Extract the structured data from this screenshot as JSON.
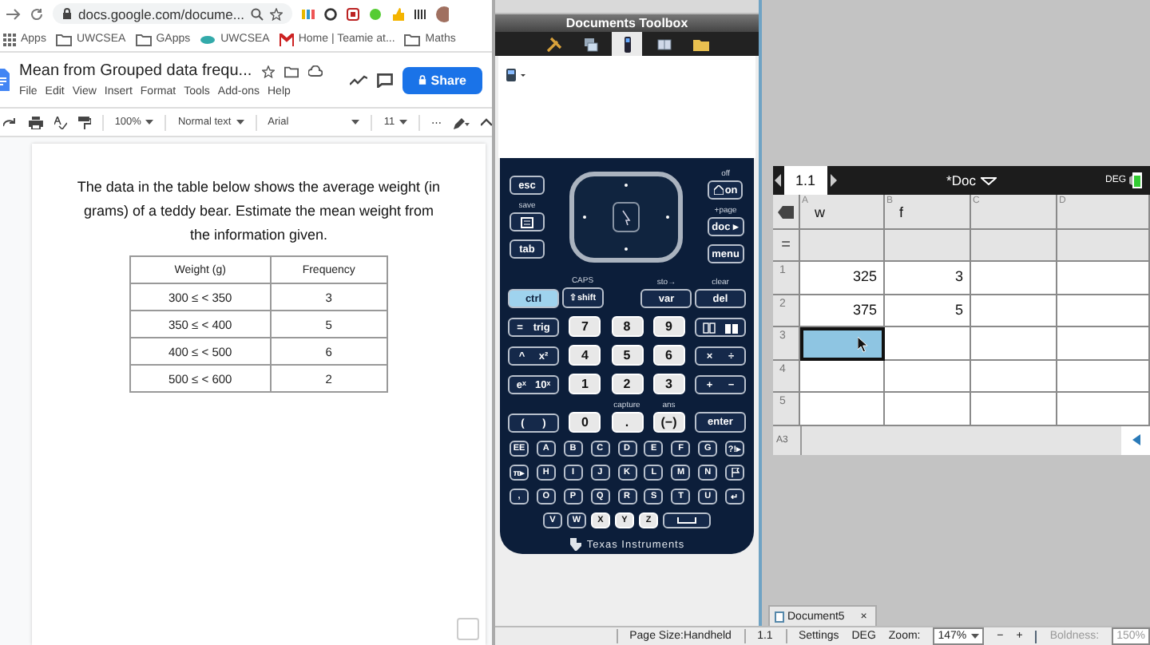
{
  "browser": {
    "url": "docs.google.com/docume...",
    "bookmarks": [
      {
        "label": "Apps",
        "kind": "apps"
      },
      {
        "label": "UWCSEA",
        "kind": "folder"
      },
      {
        "label": "GApps",
        "kind": "folder"
      },
      {
        "label": "UWCSEA",
        "kind": "site"
      },
      {
        "label": "Home | Teamie at...",
        "kind": "teamie"
      },
      {
        "label": "Maths",
        "kind": "folder"
      }
    ],
    "doc_title": "Mean from Grouped data frequ...",
    "menus": [
      "File",
      "Edit",
      "View",
      "Insert",
      "Format",
      "Tools",
      "Add-ons",
      "Help"
    ],
    "share": "Share",
    "toolbar": {
      "zoom": "100%",
      "style": "Normal text",
      "font": "Arial",
      "size": "11",
      "more": "⋯"
    },
    "paragraph": "The data in the table below shows the average weight (in grams) of a teddy bear. Estimate the mean weight from the information given.",
    "table": {
      "columns": [
        "Weight (g)",
        "Frequency"
      ],
      "rows": [
        [
          "300 ≤ < 350",
          "3"
        ],
        [
          "350 ≤ < 400",
          "5"
        ],
        [
          "400 ≤ < 500",
          "6"
        ],
        [
          "500 ≤ < 600",
          "2"
        ]
      ]
    }
  },
  "calculator": {
    "title": "Documents Toolbox",
    "toolbox_tabs": [
      {
        "kind": "utilities",
        "selected": false
      },
      {
        "kind": "explorer",
        "selected": false
      },
      {
        "kind": "keypad",
        "selected": true
      },
      {
        "kind": "book",
        "selected": false
      },
      {
        "kind": "folder",
        "selected": false
      }
    ],
    "keypad": {
      "top_left": [
        {
          "label": "esc",
          "kind": "text"
        },
        {
          "caption": "save",
          "kind": "scratchpad"
        },
        {
          "label": "tab",
          "kind": "text"
        }
      ],
      "top_right": [
        {
          "label": "on",
          "caption": "off",
          "kind": "home"
        },
        {
          "label": "doc ▸",
          "caption": "+page",
          "kind": "text"
        },
        {
          "label": "menu",
          "kind": "text"
        }
      ],
      "ctrl_key": {
        "label": "ctrl",
        "active": true
      },
      "control_row": [
        {
          "label": "⇧shift",
          "caption": "CAPS"
        },
        {
          "label": "var",
          "caption": "sto→"
        },
        {
          "label": "del",
          "caption": "clear"
        }
      ],
      "numeric_rows": [
        [
          {
            "kind": "pair",
            "labels": [
              "=",
              "trig"
            ]
          },
          {
            "kind": "digit",
            "label": "7"
          },
          {
            "kind": "digit",
            "label": "8"
          },
          {
            "kind": "digit",
            "label": "9"
          },
          {
            "kind": "pair-icons"
          }
        ],
        [
          {
            "kind": "pair",
            "labels": [
              "^",
              "x²"
            ]
          },
          {
            "kind": "digit",
            "label": "4"
          },
          {
            "kind": "digit",
            "label": "5"
          },
          {
            "kind": "digit",
            "label": "6"
          },
          {
            "kind": "pair",
            "labels": [
              "×",
              "÷"
            ]
          }
        ],
        [
          {
            "kind": "pair",
            "labels": [
              "eˣ",
              "10ˣ"
            ]
          },
          {
            "kind": "digit",
            "label": "1"
          },
          {
            "kind": "digit",
            "label": "2"
          },
          {
            "kind": "digit",
            "label": "3"
          },
          {
            "kind": "pair",
            "labels": [
              "+",
              "−"
            ]
          }
        ],
        [
          {
            "kind": "pair",
            "labels": [
              "(",
              ")"
            ]
          },
          {
            "kind": "digit",
            "label": "0"
          },
          {
            "kind": "digit",
            "label": ".",
            "caption": "capture"
          },
          {
            "kind": "digit",
            "label": "(−)",
            "caption": "ans"
          },
          {
            "kind": "dark",
            "label": "enter"
          }
        ]
      ],
      "letter_rows": [
        [
          {
            "kind": "dark",
            "label": "EE"
          },
          {
            "kind": "dark",
            "label": "A"
          },
          {
            "kind": "dark",
            "label": "B"
          },
          {
            "kind": "dark",
            "label": "C"
          },
          {
            "kind": "dark",
            "label": "D"
          },
          {
            "kind": "dark",
            "label": "E"
          },
          {
            "kind": "dark",
            "label": "F"
          },
          {
            "kind": "dark",
            "label": "G"
          },
          {
            "kind": "dark",
            "label": "?!▸"
          }
        ],
        [
          {
            "kind": "dark",
            "label": "π▸"
          },
          {
            "kind": "dark",
            "label": "H"
          },
          {
            "kind": "dark",
            "label": "I"
          },
          {
            "kind": "dark",
            "label": "J"
          },
          {
            "kind": "dark",
            "label": "K"
          },
          {
            "kind": "dark",
            "label": "L"
          },
          {
            "kind": "dark",
            "label": "M"
          },
          {
            "kind": "dark",
            "label": "N"
          },
          {
            "kind": "flag"
          }
        ],
        [
          {
            "kind": "dark",
            "label": ","
          },
          {
            "kind": "dark",
            "label": "O"
          },
          {
            "kind": "dark",
            "label": "P"
          },
          {
            "kind": "dark",
            "label": "Q"
          },
          {
            "kind": "dark",
            "label": "R"
          },
          {
            "kind": "dark",
            "label": "S"
          },
          {
            "kind": "dark",
            "label": "T"
          },
          {
            "kind": "dark",
            "label": "U"
          },
          {
            "kind": "dark",
            "label": "↵"
          }
        ],
        [
          {
            "kind": "dark",
            "label": "V"
          },
          {
            "kind": "dark",
            "label": "W"
          },
          {
            "kind": "light",
            "label": "X"
          },
          {
            "kind": "light",
            "label": "Y"
          },
          {
            "kind": "light",
            "label": "Z"
          },
          {
            "kind": "space"
          }
        ]
      ],
      "brand": "Texas Instruments"
    }
  },
  "nspire": {
    "page_tab": "1.1",
    "doc_title": "*Doc",
    "mode": "DEG",
    "formula_marker": "=",
    "columns": [
      {
        "letter": "A",
        "name": "w"
      },
      {
        "letter": "B",
        "name": "f"
      },
      {
        "letter": "C"
      },
      {
        "letter": "D"
      }
    ],
    "rows": [
      {
        "number": "1",
        "cells": [
          {
            "value": "325",
            "selected": false
          },
          {
            "value": "3",
            "selected": false
          },
          {
            "selected": false
          },
          {
            "selected": false
          }
        ]
      },
      {
        "number": "2",
        "cells": [
          {
            "value": "375",
            "selected": false
          },
          {
            "value": "5",
            "selected": false
          },
          {
            "selected": false
          },
          {
            "selected": false
          }
        ]
      },
      {
        "number": "3",
        "cells": [
          {
            "selected": true
          },
          {
            "selected": false
          },
          {
            "selected": false
          },
          {
            "selected": false
          }
        ]
      },
      {
        "number": "4",
        "cells": [
          {
            "selected": false
          },
          {
            "selected": false
          },
          {
            "selected": false
          },
          {
            "selected": false
          }
        ]
      },
      {
        "number": "5",
        "cells": [
          {
            "selected": false
          },
          {
            "selected": false
          },
          {
            "selected": false
          },
          {
            "selected": false
          }
        ]
      }
    ],
    "cell_ref": "A3",
    "document_tab": {
      "label": "Document5",
      "close": "×"
    }
  },
  "status_bar": {
    "page_size": "Page Size:Handheld",
    "page": "1.1",
    "settings": "Settings",
    "mode": "DEG",
    "zoom_label": "Zoom:",
    "zoom": "147%",
    "minus": "−",
    "plus": "+",
    "boldness_label": "Boldness:",
    "boldness": "150%"
  }
}
